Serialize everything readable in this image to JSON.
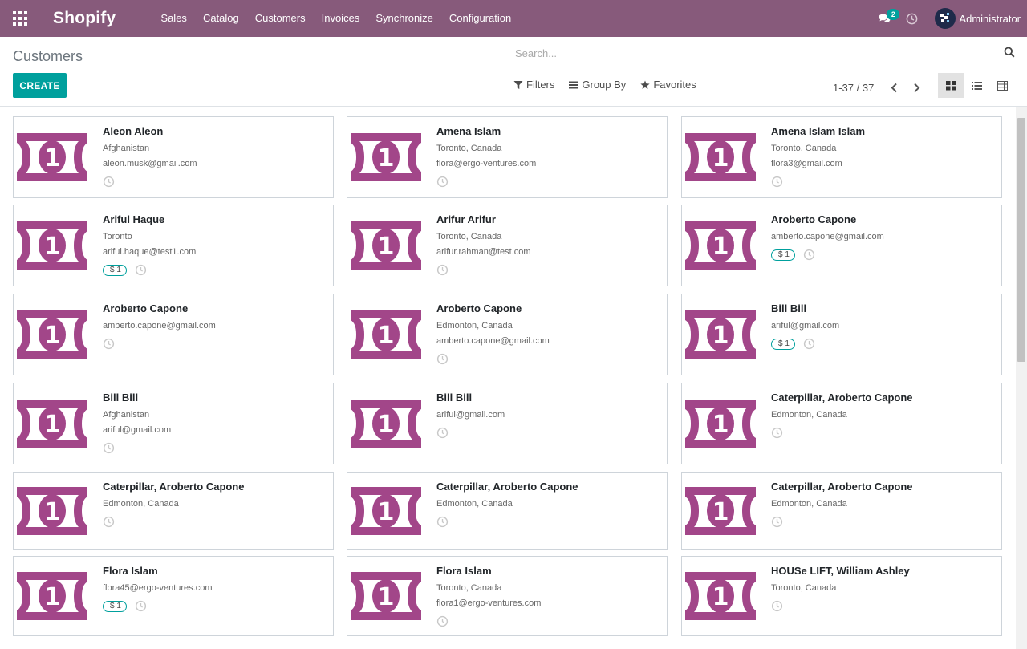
{
  "navbar": {
    "brand": "Shopify",
    "menu": [
      "Sales",
      "Catalog",
      "Customers",
      "Invoices",
      "Synchronize",
      "Configuration"
    ],
    "chat_count": "2",
    "user_name": "Administrator",
    "bg_color": "#875a7b"
  },
  "control_panel": {
    "breadcrumb": "Customers",
    "create_label": "CREATE",
    "search_placeholder": "Search...",
    "filters_label": "Filters",
    "group_by_label": "Group By",
    "favorites_label": "Favorites",
    "pager_value": "1-37 / 37",
    "views": [
      "kanban-view",
      "list-view",
      "pivot-view"
    ],
    "active_view": "kanban-view"
  },
  "customers": [
    {
      "name": "Aleon Aleon",
      "lines": [
        "Afghanistan",
        "aleon.musk@gmail.com"
      ],
      "tag": ""
    },
    {
      "name": "Amena Islam",
      "lines": [
        "Toronto, Canada",
        "flora@ergo-ventures.com"
      ],
      "tag": ""
    },
    {
      "name": "Amena Islam Islam",
      "lines": [
        "Toronto, Canada",
        "flora3@gmail.com"
      ],
      "tag": ""
    },
    {
      "name": "Ariful Haque",
      "lines": [
        "Toronto",
        "ariful.haque@test1.com"
      ],
      "tag": "$ 1"
    },
    {
      "name": "Arifur Arifur",
      "lines": [
        "Toronto, Canada",
        "arifur.rahman@test.com"
      ],
      "tag": ""
    },
    {
      "name": "Aroberto Capone",
      "lines": [
        "amberto.capone@gmail.com"
      ],
      "tag": "$ 1"
    },
    {
      "name": "Aroberto Capone",
      "lines": [
        "amberto.capone@gmail.com"
      ],
      "tag": ""
    },
    {
      "name": "Aroberto Capone",
      "lines": [
        "Edmonton, Canada",
        "amberto.capone@gmail.com"
      ],
      "tag": ""
    },
    {
      "name": "Bill Bill",
      "lines": [
        "ariful@gmail.com"
      ],
      "tag": "$ 1"
    },
    {
      "name": "Bill Bill",
      "lines": [
        "Afghanistan",
        "ariful@gmail.com"
      ],
      "tag": ""
    },
    {
      "name": "Bill Bill",
      "lines": [
        "ariful@gmail.com"
      ],
      "tag": ""
    },
    {
      "name": "Caterpillar, Aroberto Capone",
      "lines": [
        "Edmonton, Canada"
      ],
      "tag": ""
    },
    {
      "name": "Caterpillar, Aroberto Capone",
      "lines": [
        "Edmonton, Canada"
      ],
      "tag": ""
    },
    {
      "name": "Caterpillar, Aroberto Capone",
      "lines": [
        "Edmonton, Canada"
      ],
      "tag": ""
    },
    {
      "name": "Caterpillar, Aroberto Capone",
      "lines": [
        "Edmonton, Canada"
      ],
      "tag": ""
    },
    {
      "name": "Flora Islam",
      "lines": [
        "flora45@ergo-ventures.com"
      ],
      "tag": "$ 1"
    },
    {
      "name": "Flora Islam",
      "lines": [
        "Toronto, Canada",
        "flora1@ergo-ventures.com"
      ],
      "tag": ""
    },
    {
      "name": "HOUSe LIFT, William Ashley",
      "lines": [
        "Toronto, Canada"
      ],
      "tag": ""
    }
  ]
}
